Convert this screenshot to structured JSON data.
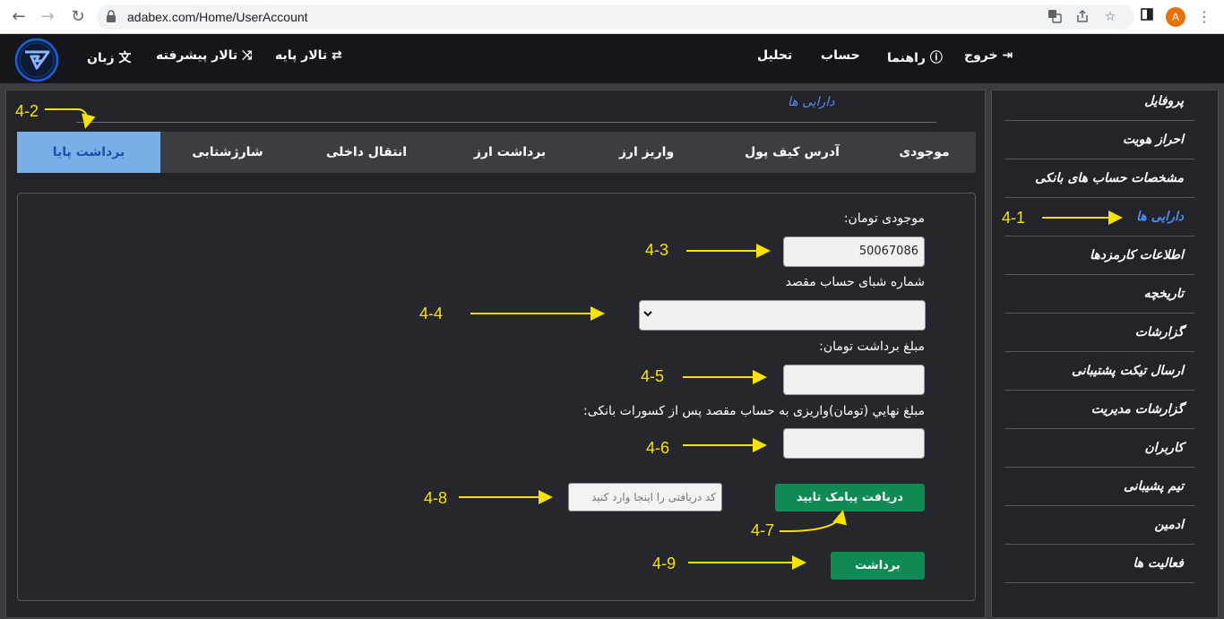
{
  "browser": {
    "url": "adabex.com/Home/UserAccount",
    "profile_initial": "A"
  },
  "header": {
    "nav": {
      "exit": "خروج",
      "guide": "راهنما",
      "account": "حساب",
      "analysis": "تحلیل",
      "basic_hall": "تالار پایه",
      "advanced_hall": "تالار پیشرفته",
      "language": "زبان"
    }
  },
  "sidebar": {
    "items": [
      {
        "label": "پروفایل",
        "active": false
      },
      {
        "label": "احراز هویت",
        "active": false
      },
      {
        "label": "مشخصات حساب های بانکی",
        "active": false
      },
      {
        "label": "دارایی ها",
        "active": true
      },
      {
        "label": "اطلاعات کارمزدها",
        "active": false
      },
      {
        "label": "تاریخچه",
        "active": false
      },
      {
        "label": "گزارشات",
        "active": false
      },
      {
        "label": "ارسال تیکت پشتیبانی",
        "active": false
      },
      {
        "label": "گزارشات مدیریت",
        "active": false
      },
      {
        "label": "کاربران",
        "active": false
      },
      {
        "label": "تیم پشیبانی",
        "active": false
      },
      {
        "label": "ادمین",
        "active": false
      },
      {
        "label": "فعالیت ها",
        "active": false
      }
    ]
  },
  "main": {
    "title": "دارایی ها",
    "tabs": [
      {
        "label": "موجودی",
        "active": false
      },
      {
        "label": "آدرس کیف پول",
        "active": false
      },
      {
        "label": "واریز ارز",
        "active": false
      },
      {
        "label": "برداشت ارز",
        "active": false
      },
      {
        "label": "انتقال داخلی",
        "active": false
      },
      {
        "label": "شارژشتابی",
        "active": false
      },
      {
        "label": "برداشت پایا",
        "active": true
      }
    ],
    "form": {
      "balance_label": "موجودی تومان:",
      "balance_value": "50067086",
      "sheba_label": "شماره شبای حساب مقصد",
      "sheba_selected": "",
      "amount_label": "مبلغ برداشت تومان:",
      "amount_value": "",
      "final_label": "مبلغ نهایي (تومان)واریزی به حساب مقصد پس از کسورات بانکی:",
      "final_value": "",
      "sms_button": "دریافت پیامک تایید",
      "code_placeholder": "کد دریافتی را اینجا وارد کنید",
      "withdraw_button": "برداشت"
    }
  },
  "annotations": [
    "4-1",
    "4-2",
    "4-3",
    "4-4",
    "4-5",
    "4-6",
    "4-7",
    "4-8",
    "4-9"
  ],
  "colors": {
    "accent_blue": "#4e8cf7",
    "active_tab_bg": "#7aaee6",
    "button_green": "#0f8a55",
    "annotation_yellow": "#f6e300",
    "header_bg": "#15161c",
    "panel_bg": "#23242a"
  }
}
